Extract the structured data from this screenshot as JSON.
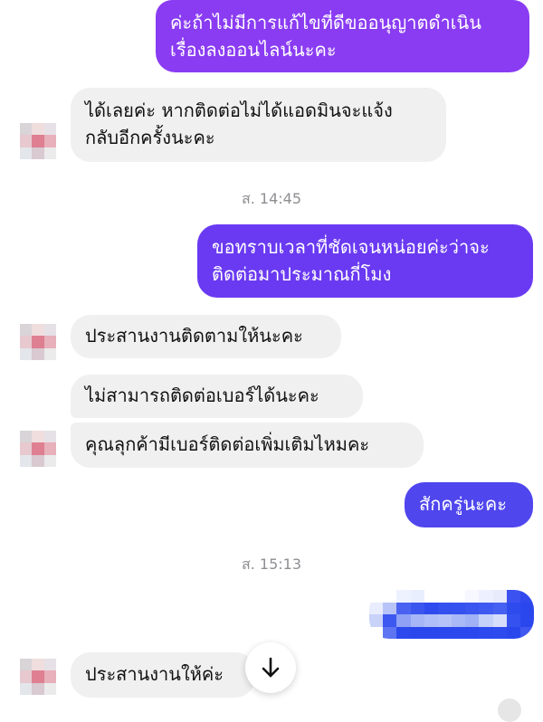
{
  "colors": {
    "outgoing_violet": "#8a3cf2",
    "outgoing_indigo": "#6a3af2",
    "outgoing_blue": "#4f46ee",
    "incoming_bg": "#f0f0f0",
    "timestamp": "#8e8e93"
  },
  "messages": [
    {
      "text": "ค่ะถ้าไม่มีการแก้ไขที่ดีขออนุญาตดำเนิน\nเรื่องลงออนไลน์นะคะ"
    },
    {
      "text": "ได้เลยค่ะ หากติดต่อไม่ได้แอดมินจะแจ้ง\nกลับอีกครั้งนะคะ"
    },
    {
      "text": "ขอทราบเวลาที่ชัดเจนหน่อยค่ะว่าจะ\nติดต่อมาประมาณกี่โมง"
    },
    {
      "text": "ประสานงานติดตามให้นะคะ"
    },
    {
      "text": "ไม่สามารถติดต่อเบอร์ได้นะคะ"
    },
    {
      "text": "คุณลุกค้ามีเบอร์ติดต่อเพิ่มเติมไหมคะ"
    },
    {
      "text": "สักครู่นะคะ"
    },
    {
      "text": "ประสานงานให้ค่ะ"
    }
  ],
  "timestamps": [
    "ส. 14:45",
    "ส. 15:13"
  ],
  "icons": {
    "scroll_down": "arrow-down-icon",
    "avatar": "blurred-avatar"
  }
}
